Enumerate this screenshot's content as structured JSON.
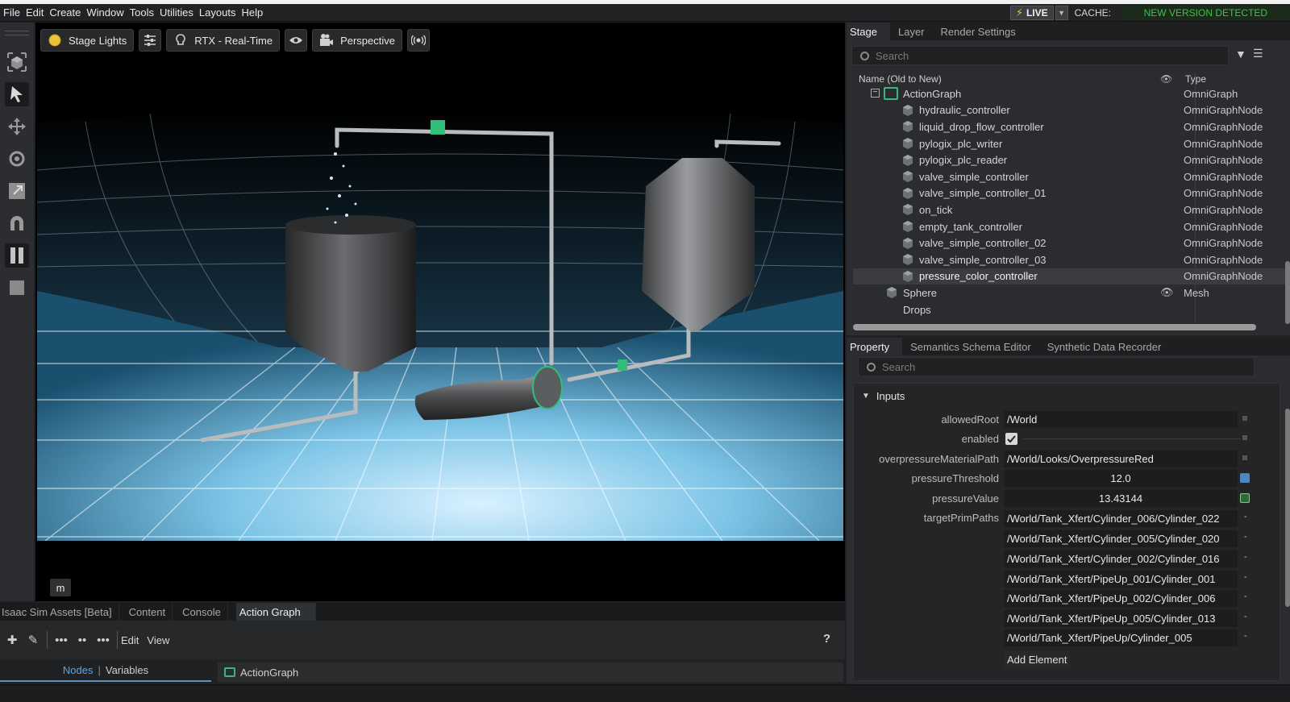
{
  "menu": [
    "File",
    "Edit",
    "Create",
    "Window",
    "Tools",
    "Utilities",
    "Layouts",
    "Help"
  ],
  "status": {
    "live_label": "LIVE",
    "cache_label": "CACHE:",
    "version_notice": "NEW VERSION DETECTED"
  },
  "viewport": {
    "toolbar": {
      "lights_label": "Stage Lights",
      "render_label": "RTX - Real-Time",
      "camera_label": "Perspective"
    },
    "chip_label": "m"
  },
  "bottom": {
    "tabs": [
      "Isaac Sim Assets [Beta]",
      "Content",
      "Console",
      "Action Graph"
    ],
    "toolbar": {
      "edit_label": "Edit",
      "view_label": "View",
      "help_label": "?"
    },
    "nodes_tab": "Nodes",
    "variables_tab": "Variables",
    "graph_tab": "ActionGraph"
  },
  "stage": {
    "tabs": [
      "Stage",
      "Layer",
      "Render Settings"
    ],
    "search_placeholder": "Search",
    "col_name": "Name (Old to New)",
    "col_type": "Type",
    "rows": [
      {
        "name": "ActionGraph",
        "type": "OmniGraph",
        "level": 0
      },
      {
        "name": "hydraulic_controller",
        "type": "OmniGraphNode",
        "level": 1
      },
      {
        "name": "liquid_drop_flow_controller",
        "type": "OmniGraphNode",
        "level": 1
      },
      {
        "name": "pylogix_plc_writer",
        "type": "OmniGraphNode",
        "level": 1
      },
      {
        "name": "pylogix_plc_reader",
        "type": "OmniGraphNode",
        "level": 1
      },
      {
        "name": "valve_simple_controller",
        "type": "OmniGraphNode",
        "level": 1
      },
      {
        "name": "valve_simple_controller_01",
        "type": "OmniGraphNode",
        "level": 1
      },
      {
        "name": "on_tick",
        "type": "OmniGraphNode",
        "level": 1
      },
      {
        "name": "empty_tank_controller",
        "type": "OmniGraphNode",
        "level": 1
      },
      {
        "name": "valve_simple_controller_02",
        "type": "OmniGraphNode",
        "level": 1
      },
      {
        "name": "valve_simple_controller_03",
        "type": "OmniGraphNode",
        "level": 1
      },
      {
        "name": "pressure_color_controller",
        "type": "OmniGraphNode",
        "level": 1
      },
      {
        "name": "Sphere",
        "type": "Mesh",
        "level": 0
      },
      {
        "name": "Drops",
        "type": "",
        "level": 0
      }
    ]
  },
  "property": {
    "tabs": [
      "Property",
      "Semantics Schema Editor",
      "Synthetic Data Recorder"
    ],
    "search_placeholder": "Search",
    "section": "Inputs",
    "fields": {
      "allowedRoot": {
        "label": "allowedRoot",
        "value": "/World"
      },
      "enabled": {
        "label": "enabled",
        "checked": true
      },
      "overpressureMaterialPath": {
        "label": "overpressureMaterialPath",
        "value": "/World/Looks/OverpressureRed"
      },
      "pressureThreshold": {
        "label": "pressureThreshold",
        "value": "12.0"
      },
      "pressureValue": {
        "label": "pressureValue",
        "value": "13.43144"
      }
    },
    "target_label": "targetPrimPaths",
    "target_paths": [
      "/World/Tank_Xfert/Cylinder_006/Cylinder_022",
      "/World/Tank_Xfert/Cylinder_005/Cylinder_020",
      "/World/Tank_Xfert/Cylinder_002/Cylinder_016",
      "/World/Tank_Xfert/PipeUp_001/Cylinder_001",
      "/World/Tank_Xfert/PipeUp_002/Cylinder_006",
      "/World/Tank_Xfert/PipeUp_005/Cylinder_013",
      "/World/Tank_Xfert/PipeUp/Cylinder_005"
    ],
    "add_element_label": "Add Element"
  },
  "colors": {
    "accent_blue": "#5ea6ea",
    "live_green": "#3fc24a",
    "graph_green": "#3cb57f"
  }
}
